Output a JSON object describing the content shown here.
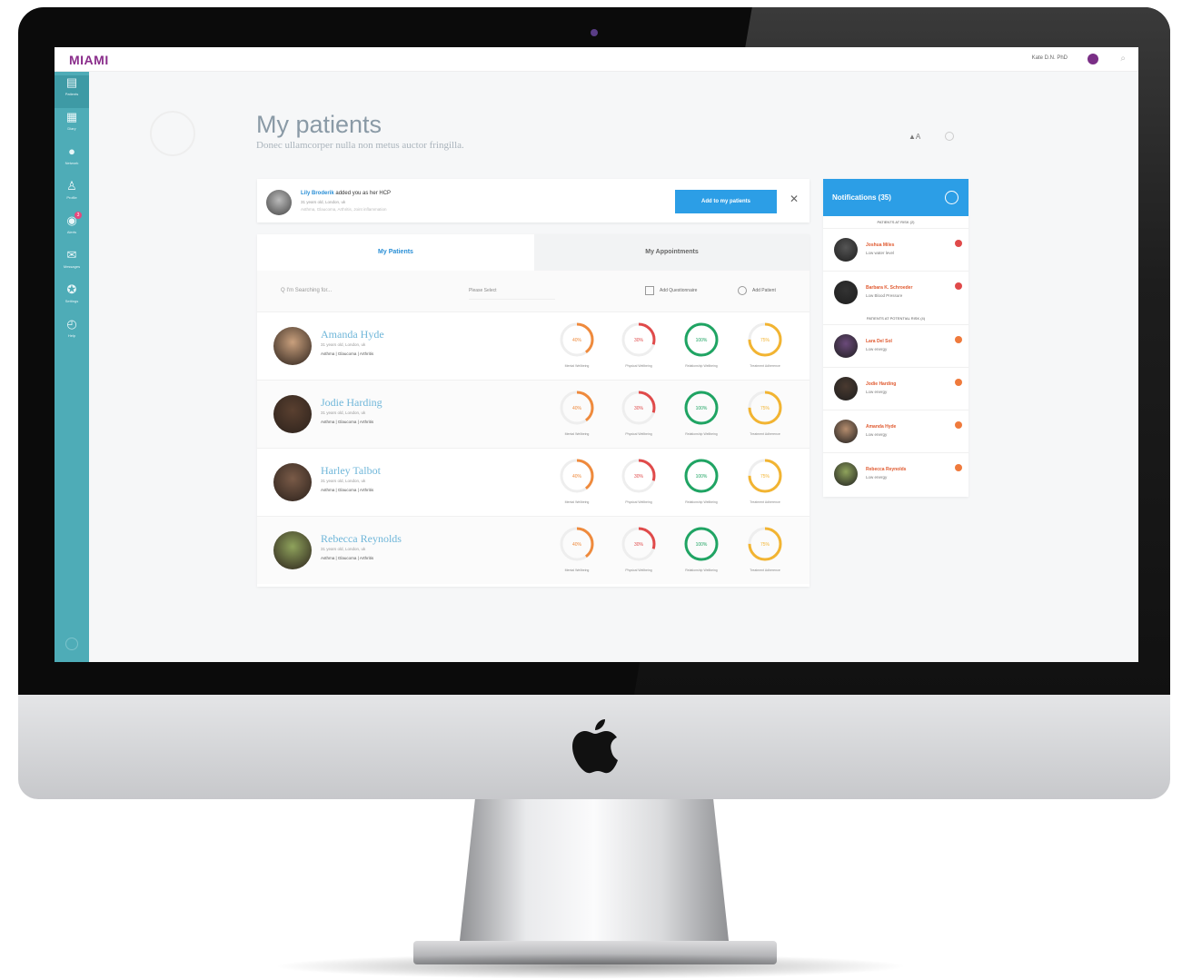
{
  "app": {
    "logo": "MIAMI",
    "user_label": "Kate D.N. PhD"
  },
  "sidebar": {
    "items": [
      {
        "icon": "patients-icon",
        "glyph": "▤",
        "label": "Patients",
        "active": true
      },
      {
        "icon": "diary-icon",
        "glyph": "▦",
        "label": "Diary"
      },
      {
        "icon": "network-icon",
        "glyph": "●",
        "label": "Network"
      },
      {
        "icon": "profile-icon",
        "glyph": "♙",
        "label": "Profile"
      },
      {
        "icon": "alerts-icon",
        "glyph": "◉",
        "label": "Alerts",
        "badge": "3"
      },
      {
        "icon": "messages-icon",
        "glyph": "✉",
        "label": "Messages"
      },
      {
        "icon": "settings-icon",
        "glyph": "✪",
        "label": "Settings"
      },
      {
        "icon": "help-icon",
        "glyph": "◴",
        "label": "Help"
      }
    ]
  },
  "page": {
    "title": "My patients",
    "subtitle": "Donec ullamcorper nulla non metus auctor fringilla.",
    "sort_label": "▲A"
  },
  "invite": {
    "name": "Lily Broderik",
    "text": "added you as her HCP",
    "meta": "31 years old, London, uk",
    "conditions": "Asthma, Glaucoma, Arthritis, Joint inflammation",
    "button": "Add to my patients",
    "close": "✕"
  },
  "tabs": {
    "patients": "My Patients",
    "appointments": "My Appointments"
  },
  "toolbar": {
    "search_placeholder": "Q  I'm Searching for...",
    "select_placeholder": "Please Select",
    "add_questionnaire": "Add Questionnaire",
    "add_patient": "Add Patient"
  },
  "gauge_labels": [
    "Mental Wellbeing",
    "Physical Wellbeing",
    "Relationship Wellbeing",
    "Treatment Adherence"
  ],
  "gauge_colors": [
    "#ef8a3c",
    "#e04a4a",
    "#1fa463",
    "#f2b431"
  ],
  "patients": [
    {
      "name": "Amanda Hyde",
      "meta": "31 years old, London, uk",
      "conditions": "Asthma | Glaucoma | Arthritis",
      "values": [
        "40%",
        "30%",
        "100%",
        "75%"
      ],
      "fractions": [
        0.4,
        0.3,
        1.0,
        0.75
      ],
      "avatar": "#c9a07d"
    },
    {
      "name": "Jodie Harding",
      "meta": "31 years old, London, uk",
      "conditions": "Asthma | Glaucoma | Arthritis",
      "values": [
        "40%",
        "30%",
        "100%",
        "75%"
      ],
      "fractions": [
        0.4,
        0.3,
        1.0,
        0.75
      ],
      "avatar": "#5a4030"
    },
    {
      "name": "Harley Talbot",
      "meta": "31 years old, London, uk",
      "conditions": "Asthma | Glaucoma | Arthritis",
      "values": [
        "40%",
        "30%",
        "100%",
        "75%"
      ],
      "fractions": [
        0.4,
        0.3,
        1.0,
        0.75
      ],
      "avatar": "#7a5b48"
    },
    {
      "name": "Rebecca Reynolds",
      "meta": "31 years old, London, uk",
      "conditions": "Asthma | Glaucoma | Arthritis",
      "values": [
        "40%",
        "30%",
        "100%",
        "75%"
      ],
      "fractions": [
        0.4,
        0.3,
        1.0,
        0.75
      ],
      "avatar": "#8fa35c"
    }
  ],
  "notifications": {
    "title": "Notifications (35)",
    "sections": [
      {
        "label": "PATIENTS AT RISK (2)",
        "items": [
          {
            "name": "Joshua Miles",
            "desc": "Low water level",
            "dot": "#e04a4a",
            "avatar": "#555"
          },
          {
            "name": "Barbara K. Schroeder",
            "desc": "Low Blood Pressure",
            "dot": "#e04a4a",
            "avatar": "#333"
          }
        ]
      },
      {
        "label": "PATIENTS AT POTENTIAL RISK (4)",
        "items": [
          {
            "name": "Lara Del Sol",
            "desc": "Low energy",
            "dot": "#ef7a3c",
            "avatar": "#6b4a7a"
          },
          {
            "name": "Jodie Harding",
            "desc": "Low energy",
            "dot": "#ef7a3c",
            "avatar": "#4a3a30"
          },
          {
            "name": "Amanda Hyde",
            "desc": "Low energy",
            "dot": "#ef7a3c",
            "avatar": "#b58d6e"
          },
          {
            "name": "Rebecca Reynolds",
            "desc": "Low energy",
            "dot": "#ef7a3c",
            "avatar": "#8fa35c"
          }
        ]
      }
    ]
  }
}
